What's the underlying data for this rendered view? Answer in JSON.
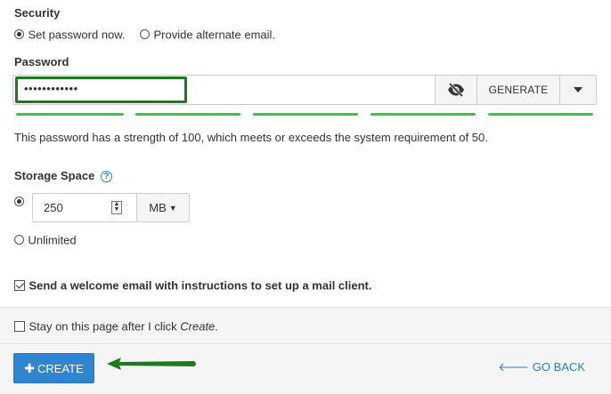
{
  "security": {
    "title": "Security",
    "options": [
      {
        "label": "Set password now.",
        "checked": true
      },
      {
        "label": "Provide alternate email.",
        "checked": false
      }
    ]
  },
  "password": {
    "title": "Password",
    "value_masked": "••••••••••••",
    "visibility_icon": "eye-slash-icon",
    "generate_label": "GENERATE",
    "dropdown_icon": "caret-down-icon",
    "strength_text": "This password has a strength of 100, which meets or exceeds the system requirement of 50.",
    "strength_bar_color": "#2ecc40",
    "strength_segments_filled": 5,
    "highlight_color": "#1f7a1f"
  },
  "storage": {
    "title": "Storage Space",
    "help_icon": "question-circle-icon",
    "value": "250",
    "unit": "MB",
    "unlimited_label": "Unlimited",
    "selected": "value"
  },
  "welcome_email": {
    "label": "Send a welcome email with instructions to set up a mail client.",
    "checked": true
  },
  "footer": {
    "stay_prefix": "Stay on this page after I click ",
    "stay_emphasis": "Create",
    "stay_suffix": ".",
    "stay_checked": false,
    "create_label": "CREATE",
    "go_back_label": "GO BACK",
    "accent_color": "#2f86d0"
  }
}
